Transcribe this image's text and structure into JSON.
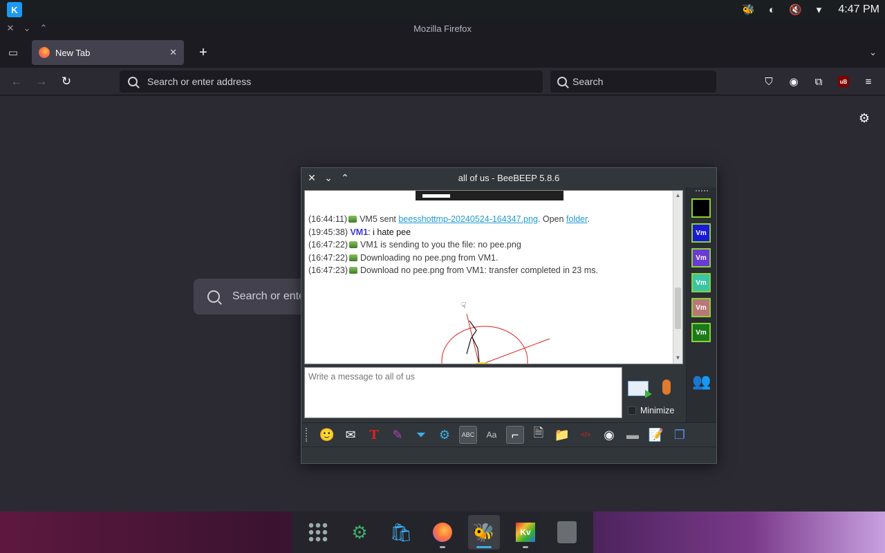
{
  "system_tray": {
    "clock": "4:47 PM"
  },
  "firefox": {
    "window_title": "Mozilla Firefox",
    "tab": {
      "label": "New Tab"
    },
    "urlbar_placeholder": "Search or enter address",
    "searchbar_placeholder": "Search",
    "newtab_search_placeholder": "Search or ente"
  },
  "beebeep": {
    "window_title": "all of us - BeeBEEP 5.8.6",
    "messages": [
      {
        "time": "(16:44:11)",
        "pre": "VM5 sent ",
        "link": "beesshottmp-20240524-164347.png",
        "mid": ". Open ",
        "link2": "folder",
        "post": "."
      },
      {
        "time": "(19:45:38)",
        "user": "VM1",
        "text": ": i hate pee"
      },
      {
        "time": "(16:47:22)",
        "text": "VM1 is sending to you the file: no pee.png"
      },
      {
        "time": "(16:47:22)",
        "text": "Downloading no pee.png from VM1."
      },
      {
        "time": "(16:47:23)",
        "text": "Download no pee.png from VM1: transfer completed in 23 ms."
      }
    ],
    "compose_placeholder": "Write a message to all of us",
    "minimize_label": "Minimize",
    "users": [
      {
        "label": "",
        "color": "#000000"
      },
      {
        "label": "Vm",
        "color": "#1a1ad6"
      },
      {
        "label": "Vm",
        "color": "#6a3ad6"
      },
      {
        "label": "Vm",
        "color": "#3ac6a6"
      },
      {
        "label": "Vm",
        "color": "#b87878"
      },
      {
        "label": "Vm",
        "color": "#1a7a1a"
      }
    ],
    "accent_border": "#8cd136"
  }
}
